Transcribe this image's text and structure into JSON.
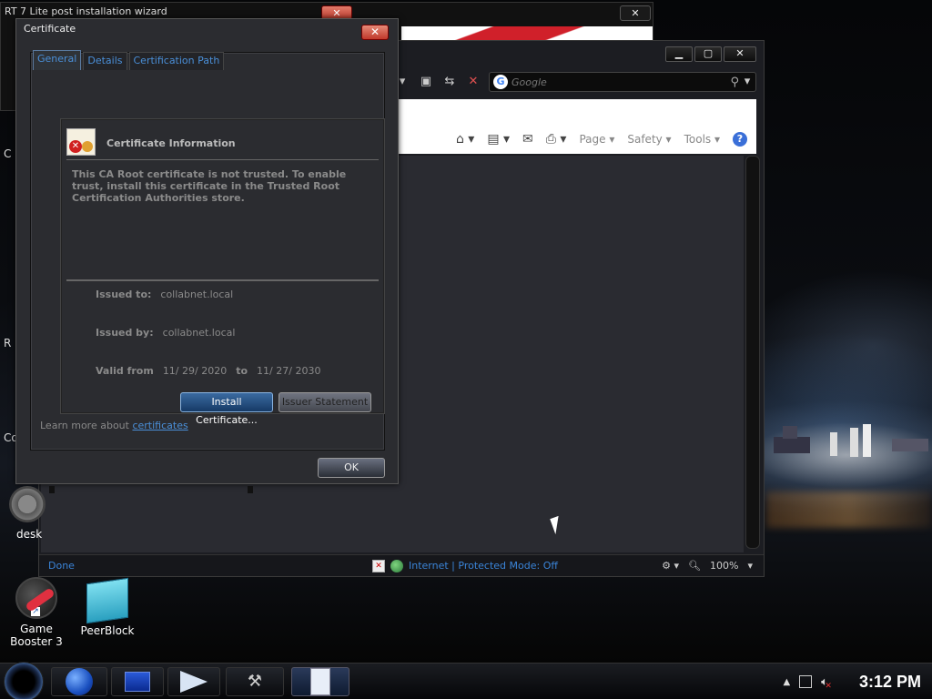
{
  "wizard": {
    "title": "RT 7 Lite post installation wizard",
    "close_glyph": "✕"
  },
  "ie": {
    "search_placeholder": "Google",
    "commands": {
      "page": "Page ▾",
      "safety": "Safety ▾",
      "tools": "Tools ▾"
    },
    "status": {
      "done": "Done",
      "zone": "Internet | Protected Mode: Off",
      "zoom": "100%"
    }
  },
  "certificate": {
    "title": "Certificate",
    "tabs": [
      "General",
      "Details",
      "Certification Path"
    ],
    "heading": "Certificate Information",
    "message": "This CA Root certificate is not trusted. To enable trust, install this certificate in the Trusted Root Certification Authorities store.",
    "issued_to_label": "Issued to:",
    "issued_to_value": "collabnet.local",
    "issued_by_label": "Issued by:",
    "issued_by_value": "collabnet.local",
    "valid_from_label": "Valid from",
    "valid_from_value": "11/ 29/ 2020",
    "valid_to_label": "to",
    "valid_to_value": "11/ 27/ 2030",
    "install_button": "Install Certificate...",
    "issuer_button": "Issuer Statement",
    "learn_prefix": "Learn more about ",
    "learn_link": "certificates",
    "ok_button": "OK"
  },
  "desktop": {
    "icons": [
      {
        "label": "Game Booster 3"
      },
      {
        "label": "PeerBlock"
      }
    ],
    "partial_label": "desk",
    "edge_letters": [
      "C",
      "R",
      "Co"
    ]
  },
  "taskbar": {
    "clock": "3:12 PM"
  }
}
